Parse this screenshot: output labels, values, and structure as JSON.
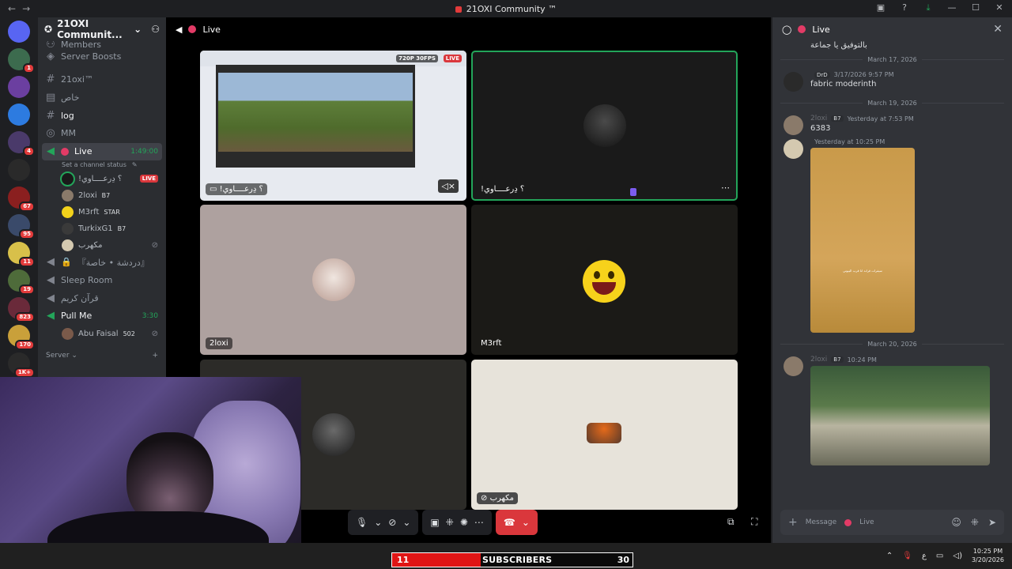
{
  "window": {
    "title": "21OXI Community ™",
    "nav_back": "←",
    "nav_forward": "→"
  },
  "guilds": [
    {
      "badge": ""
    },
    {
      "badge": "1"
    },
    {
      "badge": ""
    },
    {
      "badge": ""
    },
    {
      "badge": "4"
    },
    {
      "badge": ""
    },
    {
      "badge": "67"
    },
    {
      "badge": "95"
    },
    {
      "badge": "11"
    },
    {
      "badge": "19"
    },
    {
      "badge": "823"
    },
    {
      "badge": "170"
    },
    {
      "badge": "1K+"
    },
    {
      "badge": ""
    }
  ],
  "server": {
    "name": "21OXI Communit...",
    "members_label": "Members",
    "boosts_label": "Server Boosts"
  },
  "channels": {
    "text1": "21oxi™",
    "text2": "خاص",
    "text3": "log",
    "text4": "MM",
    "voice_active": {
      "name": "Live",
      "time": "1:49:00",
      "status": "Set a channel status"
    },
    "members": [
      {
        "name": "!؟ دِرعــــاوي",
        "tag": "",
        "live": "LIVE"
      },
      {
        "name": "2loxi",
        "tag": "B7"
      },
      {
        "name": "M3rft",
        "tag": "STAR"
      },
      {
        "name": "TurkixG1",
        "tag": "B7"
      },
      {
        "name": "مكهرب",
        "tag": ""
      }
    ],
    "voice2": "『دردشة • خاصة』",
    "voice3": "Sleep Room",
    "voice4": "قرآن كريم",
    "voice5": {
      "name": "Pull Me",
      "time": "3:30"
    },
    "voice5_member": {
      "name": "Abu Faisal",
      "tag": "502"
    },
    "category": "Server"
  },
  "stage": {
    "title": "Live",
    "stream_quality": "720P 30FPS",
    "stream_live": "LIVE",
    "tiles": [
      {
        "name": "!؟ دِرعــــاوي"
      },
      {
        "name": "!؟ دِرعــــاوي"
      },
      {
        "name": "2loxi"
      },
      {
        "name": "M3rft"
      },
      {
        "name": ""
      },
      {
        "name": "مكهرب"
      }
    ]
  },
  "chat": {
    "title": "Live",
    "top_text": "بالتوفيق يا جماعة",
    "messages": [
      {
        "date": "March 17, 2026",
        "user": "",
        "tag": "DrD",
        "time": "3/17/2026 9:57 PM",
        "body": "fabric moderinth"
      },
      {
        "date": "March 19, 2026",
        "user": "2loxi",
        "tag": "B7",
        "time": "Yesterday at 7:53 PM",
        "body": "6383"
      },
      {
        "date": "",
        "user": "",
        "tag": "",
        "time": "Yesterday at 10:25 PM",
        "body": ""
      },
      {
        "date": "March 20, 2026",
        "user": "2loxi",
        "tag": "B7",
        "time": "10:24 PM",
        "body": ""
      }
    ],
    "image_caption": "سيفرات قراند انا قرب البيوتي",
    "composer_placeholder": "Message",
    "composer_channel": "Live"
  },
  "overlay": {
    "sub_count": "11",
    "sub_label": "SUBSCRIBERS",
    "sub_goal": "30"
  },
  "taskbar": {
    "lang": "ع",
    "time": "10:25 PM",
    "date": "3/20/2026"
  }
}
